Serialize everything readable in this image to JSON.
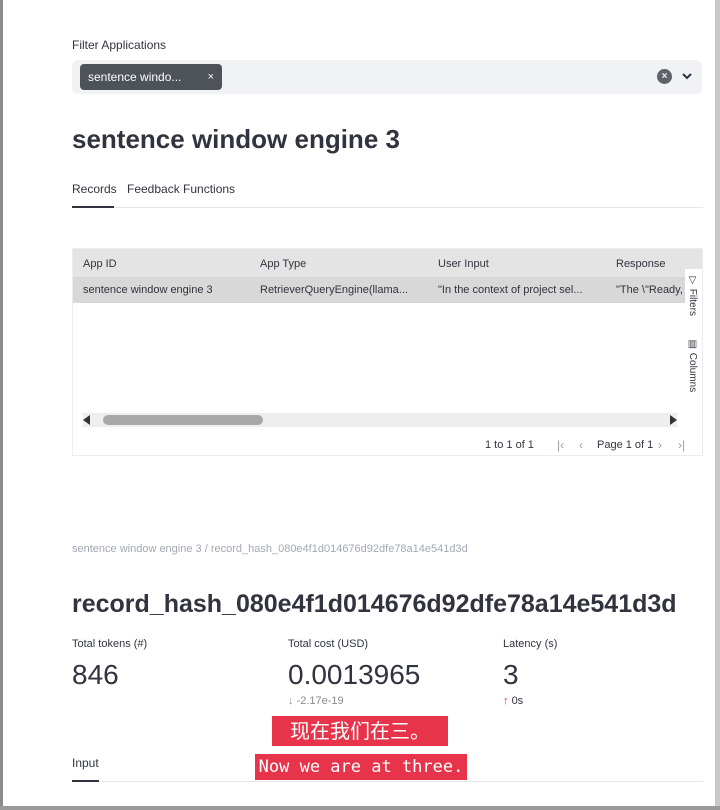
{
  "filter": {
    "label": "Filter Applications",
    "chip_label": "sentence windo...",
    "chip_remove": "×",
    "clear_icon": "×"
  },
  "app": {
    "title": "sentence window engine 3"
  },
  "tabs": [
    {
      "label": "Records",
      "active": true
    },
    {
      "label": "Feedback Functions",
      "active": false
    }
  ],
  "grid": {
    "columns": [
      "App ID",
      "App Type",
      "User Input",
      "Response"
    ],
    "rows": [
      [
        "sentence window engine 3",
        "RetrieverQueryEngine(llama...",
        "\"In the context of project sel...",
        "\"The \\\"Ready,"
      ]
    ],
    "side_panel": {
      "filters": "Filters",
      "columns": "Columns"
    },
    "pager": {
      "count": "1 to 1 of 1",
      "page": "Page 1 of 1"
    }
  },
  "detail": {
    "breadcrumb": "sentence window engine 3 / record_hash_080e4f1d014676d92dfe78a14e541d3d",
    "title": "record_hash_080e4f1d014676d92dfe78a14e541d3d",
    "metrics": [
      {
        "label": "Total tokens (#)",
        "value": "846",
        "delta": ""
      },
      {
        "label": "Total cost (USD)",
        "value": "0.0013965",
        "delta": "-2.17e-19",
        "delta_direction": "down"
      },
      {
        "label": "Latency (s)",
        "value": "3",
        "delta": "0s",
        "delta_direction": "up"
      }
    ],
    "bottom_tab": "Input"
  },
  "subtitle": {
    "zh": "现在我们在三。",
    "en": "Now we are at three."
  },
  "colors": {
    "accent_red": "#e8344a",
    "chip_bg": "#4d5359",
    "delta_up_arrow": "#ff2b2b"
  }
}
